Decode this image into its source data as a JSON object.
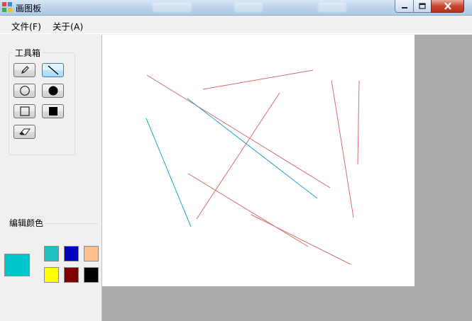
{
  "window": {
    "title": "画图板",
    "controls": {
      "minimize": "minimize",
      "maximize": "maximize",
      "close": "close"
    }
  },
  "menu": {
    "items": [
      {
        "label": "文件(F)"
      },
      {
        "label": "关于(A)"
      }
    ]
  },
  "toolbox": {
    "title": "工具箱",
    "tools": [
      {
        "name": "pencil",
        "icon": "pencil-icon",
        "selected": false
      },
      {
        "name": "line",
        "icon": "line-icon",
        "selected": true
      },
      {
        "name": "circle-outline",
        "icon": "circle-outline-icon",
        "selected": false
      },
      {
        "name": "circle-filled",
        "icon": "circle-filled-icon",
        "selected": false
      },
      {
        "name": "rectangle-outline",
        "icon": "rectangle-outline-icon",
        "selected": false
      },
      {
        "name": "rectangle-filled",
        "icon": "rectangle-filled-icon",
        "selected": false
      },
      {
        "name": "eraser",
        "icon": "eraser-icon",
        "selected": false
      }
    ]
  },
  "colors": {
    "title": "编辑颜色",
    "current": "#00c5cd",
    "palette": [
      "#1ec0c0",
      "#0000c0",
      "#ffc08c",
      "#ffff00",
      "#800000",
      "#000000"
    ]
  },
  "canvas": {
    "stroke_colors": {
      "red": "#d96b6b",
      "cyan": "#1aa7c9"
    }
  }
}
